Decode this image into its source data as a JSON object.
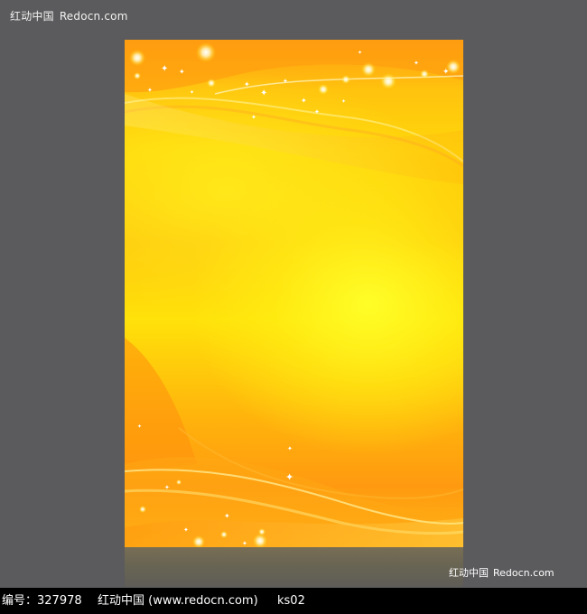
{
  "watermark": {
    "top_cn": "红动中国",
    "top_en": "Redocn.com",
    "right_cn": "红动中国",
    "right_en": "Redocn.com"
  },
  "footer": {
    "id_label": "编号：327978",
    "site": "红动中国 (www.redocn.com)",
    "code": "ks02"
  },
  "colors": {
    "background": "#5b5a5c",
    "poster_primary": "#ffd60a",
    "poster_accent": "#ff9c12",
    "footer_bar": "#000000"
  }
}
